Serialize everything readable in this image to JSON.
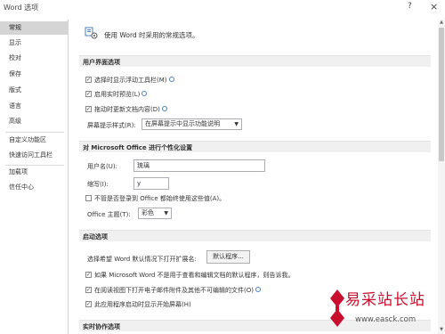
{
  "window": {
    "title": "Word 选项",
    "help": "?",
    "close": "×"
  },
  "sidebar": {
    "items": [
      {
        "label": "常规",
        "selected": true
      },
      {
        "label": "显示"
      },
      {
        "label": "校对"
      },
      {
        "label": "保存"
      },
      {
        "label": "版式"
      },
      {
        "label": "语言"
      },
      {
        "label": "高级"
      },
      {
        "label": "自定义功能区"
      },
      {
        "label": "快速访问工具栏"
      },
      {
        "label": "加载项"
      },
      {
        "label": "信任中心"
      }
    ]
  },
  "header": {
    "text": "使用 Word 时采用的常规选项。"
  },
  "ui_section": {
    "title": "用户界面选项",
    "options": [
      {
        "label": "选择时显示浮动工具栏(M)",
        "checked": true
      },
      {
        "label": "启用实时预览(L)",
        "checked": true
      },
      {
        "label": "拖动时更新文档内容(D)",
        "checked": true
      }
    ],
    "tooltip_label": "屏幕提示样式(R):",
    "tooltip_value": "在屏幕提示中显示功能说明"
  },
  "personal_section": {
    "title": "对 Microsoft Office 进行个性化设置",
    "username_label": "用户名(U):",
    "username_value": "琉璃",
    "initials_label": "缩写(I):",
    "initials_value": "y",
    "always_use_label": "不管是否登录到 Office 都始终使用这些值(A)。",
    "always_use_checked": false,
    "theme_label": "Office 主题(T):",
    "theme_value": "彩色"
  },
  "startup_section": {
    "title": "启动选项",
    "ext_label": "选择希望 Word 默认情况下打开扩展名:",
    "default_programs": "默认程序...",
    "options": [
      {
        "label": "如果 Microsoft Word 不是用于查看和编辑文档的默认程序，则告诉我。",
        "checked": true
      },
      {
        "label": "在阅读视图下打开电子邮件附件及其他不可编辑的文件(O)",
        "checked": true
      },
      {
        "label": "此应用程序启动时显示开始屏幕(H)",
        "checked": true
      }
    ]
  },
  "collab_section": {
    "title": "实时协作选项"
  },
  "watermark": {
    "cn": "易采站长站",
    "url": "www.easck.com"
  },
  "colors": {
    "selected_bg": "#d5d5d5",
    "section_bg": "#f0f0f0",
    "info_blue": "#4a7fc0",
    "watermark_red": "#c8102e"
  }
}
